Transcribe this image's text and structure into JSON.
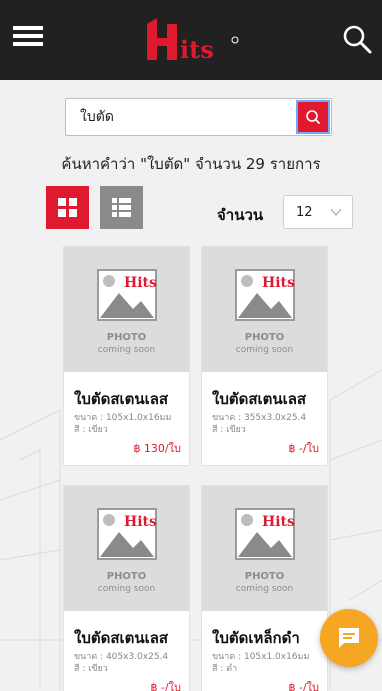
{
  "header": {
    "menu_icon": "hamburger-menu-icon",
    "logo_text": "Hits",
    "search_icon": "magnifier-icon"
  },
  "search": {
    "value": "ใบตัด",
    "submit_icon": "search-icon"
  },
  "results": {
    "summary": "ค้นหาคำว่า \"ใบตัด\" จำนวน 29 รายการ"
  },
  "view": {
    "grid_icon": "grid-view-icon",
    "list_icon": "list-view-icon",
    "qty_label": "จำนวน",
    "qty_value": "12"
  },
  "placeholder": {
    "photo": "PHOTO",
    "coming": "coming soon",
    "logo": "Hits"
  },
  "products": [
    {
      "name": "ใบตัดสเตนเลส",
      "size": "ขนาด : 105x1.0x16มม",
      "color": "สี : เขียว",
      "price": "฿ 130/ใบ"
    },
    {
      "name": "ใบตัดสเตนเลส",
      "size": "ขนาด : 355x3.0x25.4",
      "color": "สี : เขียว",
      "price": "฿ -/ใบ"
    },
    {
      "name": "ใบตัดสเตนเลส",
      "size": "ขนาด : 405x3.0x25.4",
      "color": "สี : เขียว",
      "price": "฿ -/ใบ"
    },
    {
      "name": "ใบตัดเหล็กดำ",
      "size": "ขนาด : 105x1.0x16มม",
      "color": "สี : ดำ",
      "price": "฿ -/ใบ"
    }
  ],
  "colors": {
    "brand_red": "#e0192f",
    "header_bg": "#212121",
    "chat_fab": "#f5a623"
  },
  "chat": {
    "icon": "chat-bubble-icon"
  }
}
